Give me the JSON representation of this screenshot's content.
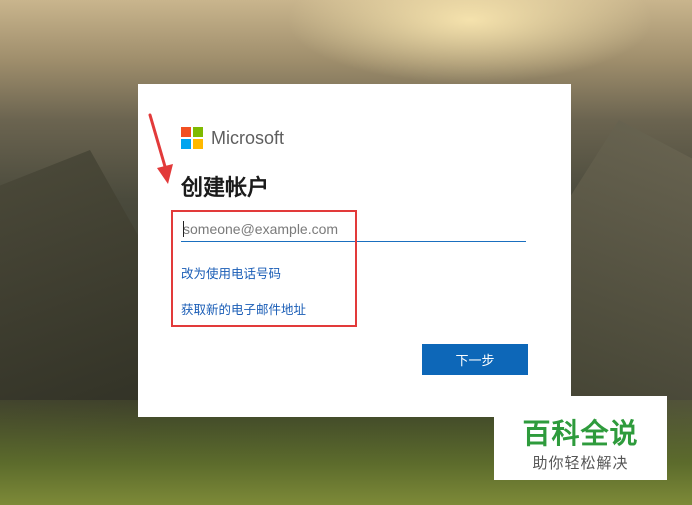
{
  "brand": {
    "name": "Microsoft",
    "colors": [
      "#f25022",
      "#7fba00",
      "#00a4ef",
      "#ffb900"
    ]
  },
  "form": {
    "title": "创建帐户",
    "email_placeholder": "someone@example.com",
    "link_phone": "改为使用电话号码",
    "link_new_email": "获取新的电子邮件地址",
    "next_label": "下一步"
  },
  "annotation": {
    "color": "#e23a3a"
  },
  "watermark": {
    "main": "百科全说",
    "sub": "助你轻松解决"
  },
  "colors": {
    "accent": "#0d67b8",
    "link": "#1a5db6"
  }
}
